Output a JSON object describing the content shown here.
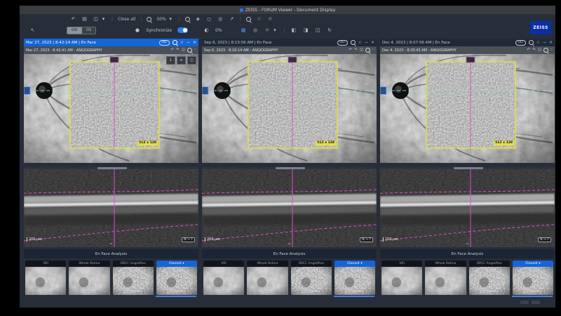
{
  "window": {
    "title": "ZEISS - FORUM Viewer - Document Display"
  },
  "brand": {
    "logo": "ZEISS"
  },
  "toolbar": {
    "close_all": "Close all",
    "zoom_level": "50%",
    "od": "OD",
    "os": "OS",
    "synchronize": "Synchronize",
    "opacity": "0%"
  },
  "icons": {
    "back": "↶",
    "print": "▤",
    "save": "◫",
    "caret_down": "▾",
    "caret_up": "^",
    "zoom_minus": "−",
    "zoom_plus": "+",
    "hand": "◈",
    "fit": "◻",
    "target": "◎",
    "expand": "↗",
    "star": "☆",
    "gear": "☼",
    "pointer": "↖",
    "info": "●",
    "grid": "▦",
    "half": "◐",
    "imgA": "◧",
    "imgB": "◨",
    "imgC": "◫",
    "rotate": "↻",
    "undo": "↶",
    "redo": "↷",
    "square": "◫",
    "dot": "◦",
    "minus": "−",
    "close": "×",
    "pipe": "|"
  },
  "columns": [
    {
      "header": "Mar 27, 2023 | 8:42:14 AM | En Face",
      "laterality": "OD",
      "sub": "Mar 27, 2023 - 8:42:41 AM - ANGIOGRAPHY",
      "view_badge": "1",
      "roi_label": "512 x 128",
      "scale_label": "200 µm",
      "orientation": "N → T",
      "analysis_label": "En Face Analysis",
      "thumbs": [
        {
          "label": "VRI"
        },
        {
          "label": "Whole Retina"
        },
        {
          "label": "ORCC AngioPlex"
        },
        {
          "label": "Choroid"
        }
      ]
    },
    {
      "header": "Sep 6, 2023 | 8:13:56 AM | En Face",
      "laterality": "OD",
      "sub": "Sep 6, 2023 - 8:16:14 AM - ANGIOGRAPHY",
      "roi_label": "512 x 128",
      "scale_label": "200 µm",
      "orientation": "N → T",
      "analysis_label": "En Face Analysis",
      "thumbs": [
        {
          "label": "VRI"
        },
        {
          "label": "Whole Retina"
        },
        {
          "label": "ORCC AngioPlex"
        },
        {
          "label": "Choroid"
        }
      ]
    },
    {
      "header": "Dec 4, 2023 | 8:07:56 AM | En Face",
      "laterality": "OD",
      "sub": "Dec 4, 2023 - 8:20:43 AM - ANGIOGRAPHY",
      "roi_label": "512 x 128",
      "scale_label": "200 µm",
      "orientation": "N → T",
      "analysis_label": "En Face Analysis",
      "thumbs": [
        {
          "label": "VRI"
        },
        {
          "label": "Whole Retina"
        },
        {
          "label": "ORCC AngioPlex"
        },
        {
          "label": "Choroid"
        }
      ]
    }
  ]
}
